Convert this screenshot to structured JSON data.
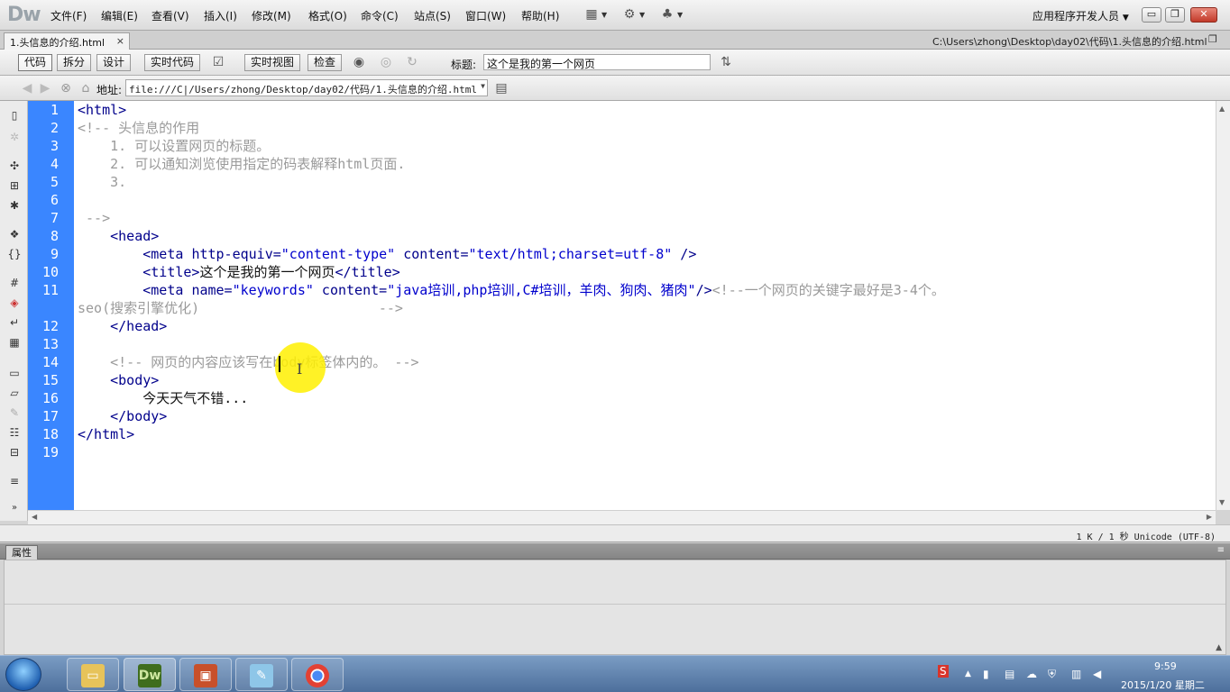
{
  "app": {
    "logo": "Dw",
    "menus": [
      "文件(F)",
      "编辑(E)",
      "查看(V)",
      "插入(I)",
      "修改(M)",
      "格式(O)",
      "命令(C)",
      "站点(S)",
      "窗口(W)",
      "帮助(H)"
    ],
    "workspace": "应用程序开发人员",
    "window_controls": [
      "▭",
      "❐",
      "✕"
    ]
  },
  "tab": {
    "label": "1.头信息的介绍.html",
    "close": "×",
    "filepath": "C:\\Users\\zhong\\Desktop\\day02\\代码\\1.头信息的介绍.html"
  },
  "doc_toolbar": {
    "code": "代码",
    "split": "拆分",
    "design": "设计",
    "live_code": "实时代码",
    "live_view": "实时视图",
    "inspect": "检查",
    "title_label": "标题:",
    "title_value": "这个是我的第一个网页"
  },
  "address": {
    "label": "地址:",
    "value": "file:///C|/Users/zhong/Desktop/day02/代码/1.头信息的介绍.html"
  },
  "code_lines": [
    {
      "n": "1",
      "parts": [
        [
          "tag",
          "<html>"
        ]
      ]
    },
    {
      "n": "2",
      "parts": [
        [
          "cmt",
          "<!-- 头信息的作用"
        ]
      ]
    },
    {
      "n": "3",
      "parts": [
        [
          "cmt",
          "    1. 可以设置网页的标题。"
        ]
      ]
    },
    {
      "n": "4",
      "parts": [
        [
          "cmt",
          "    2. 可以通知浏览使用指定的码表解释html页面."
        ]
      ]
    },
    {
      "n": "5",
      "parts": [
        [
          "cmt",
          "    3."
        ]
      ]
    },
    {
      "n": "6",
      "parts": []
    },
    {
      "n": "7",
      "parts": [
        [
          "cmt",
          " -->"
        ]
      ]
    },
    {
      "n": "8",
      "parts": [
        [
          "tag",
          "    <head>"
        ]
      ]
    },
    {
      "n": "9",
      "parts": [
        [
          "tag",
          "        <meta "
        ],
        [
          "attr",
          "http-equiv="
        ],
        [
          "val",
          "\"content-type\""
        ],
        [
          "attr",
          " content="
        ],
        [
          "val",
          "\"text/html;charset=utf-8\""
        ],
        [
          "tag",
          " />"
        ]
      ]
    },
    {
      "n": "10",
      "parts": [
        [
          "tag",
          "        <title>"
        ],
        [
          "txt",
          "这个是我的第一个网页"
        ],
        [
          "tag",
          "</title>"
        ]
      ]
    },
    {
      "n": "11",
      "parts": [
        [
          "tag",
          "        <meta "
        ],
        [
          "attr",
          "name="
        ],
        [
          "val",
          "\"keywords\""
        ],
        [
          "attr",
          " content="
        ],
        [
          "val",
          "\"java培训,php培训,C#培训，羊肉、狗肉、猪肉\""
        ],
        [
          "tag",
          "/>"
        ],
        [
          "cmt",
          "<!--一个网页的关键字最好是3-4个。"
        ]
      ]
    },
    {
      "n": "",
      "parts": [
        [
          "cmt",
          "seo(搜索引擎优化)                      -->"
        ]
      ]
    },
    {
      "n": "12",
      "parts": [
        [
          "tag",
          "    </head>"
        ]
      ]
    },
    {
      "n": "13",
      "parts": []
    },
    {
      "n": "14",
      "parts": [
        [
          "cmt",
          "    <!-- 网页的内容应该写在body标签体内的。 -->"
        ]
      ]
    },
    {
      "n": "15",
      "parts": [
        [
          "tag",
          "    <body>"
        ]
      ]
    },
    {
      "n": "16",
      "parts": [
        [
          "txt",
          "        今天天气不错..."
        ]
      ]
    },
    {
      "n": "17",
      "parts": [
        [
          "tag",
          "    </body>"
        ]
      ]
    },
    {
      "n": "18",
      "parts": [
        [
          "tag",
          "</html>"
        ]
      ]
    },
    {
      "n": "19",
      "parts": []
    }
  ],
  "status": {
    "text": "1 K / 1 秒 Unicode (UTF-8)"
  },
  "properties": {
    "title": "属性"
  },
  "taskbar": {
    "time": "9:59",
    "date": "2015/1/20 星期二",
    "apps": [
      "explorer",
      "Dw",
      "powerpoint",
      "notepad",
      "chrome"
    ]
  }
}
